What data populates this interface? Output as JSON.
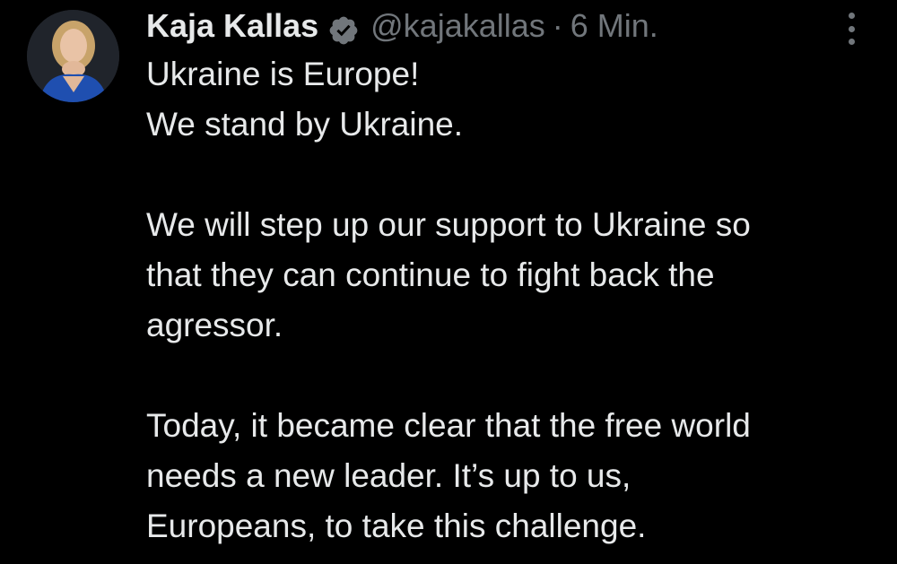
{
  "author": {
    "display_name": "Kaja Kallas",
    "handle": "@kajakallas",
    "separator": "·",
    "time": "6 Min.",
    "verified": true,
    "verified_color": "#71767b",
    "avatar_icon": "profile-photo"
  },
  "more_icon": "vertical-ellipsis-icon",
  "tweet": {
    "lines_block1": [
      "Ukraine is Europe!",
      "We stand by Ukraine."
    ],
    "lines_block2": [
      "We will step up our support to Ukraine so",
      "that they can continue to fight back the",
      "agressor."
    ],
    "lines_block3": [
      "Today, it became clear that the free world",
      "needs a new leader. It’s up to us,",
      "Europeans, to take this challenge."
    ]
  },
  "colors": {
    "background": "#000000",
    "text": "#e7e9ea",
    "secondary": "#71767b"
  }
}
